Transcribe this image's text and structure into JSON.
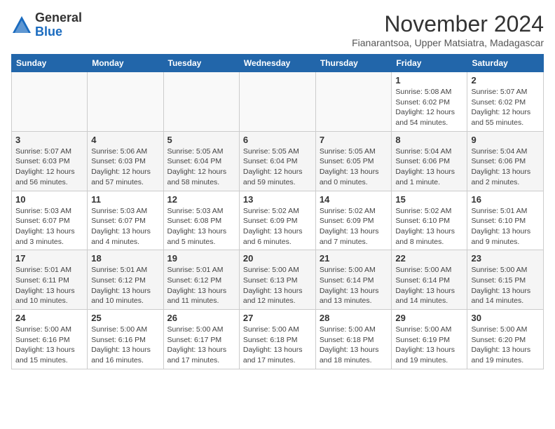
{
  "logo": {
    "general": "General",
    "blue": "Blue"
  },
  "title": "November 2024",
  "subtitle": "Fianarantsoa, Upper Matsiatra, Madagascar",
  "headers": [
    "Sunday",
    "Monday",
    "Tuesday",
    "Wednesday",
    "Thursday",
    "Friday",
    "Saturday"
  ],
  "weeks": [
    [
      {
        "day": "",
        "info": ""
      },
      {
        "day": "",
        "info": ""
      },
      {
        "day": "",
        "info": ""
      },
      {
        "day": "",
        "info": ""
      },
      {
        "day": "",
        "info": ""
      },
      {
        "day": "1",
        "info": "Sunrise: 5:08 AM\nSunset: 6:02 PM\nDaylight: 12 hours\nand 54 minutes."
      },
      {
        "day": "2",
        "info": "Sunrise: 5:07 AM\nSunset: 6:02 PM\nDaylight: 12 hours\nand 55 minutes."
      }
    ],
    [
      {
        "day": "3",
        "info": "Sunrise: 5:07 AM\nSunset: 6:03 PM\nDaylight: 12 hours\nand 56 minutes."
      },
      {
        "day": "4",
        "info": "Sunrise: 5:06 AM\nSunset: 6:03 PM\nDaylight: 12 hours\nand 57 minutes."
      },
      {
        "day": "5",
        "info": "Sunrise: 5:05 AM\nSunset: 6:04 PM\nDaylight: 12 hours\nand 58 minutes."
      },
      {
        "day": "6",
        "info": "Sunrise: 5:05 AM\nSunset: 6:04 PM\nDaylight: 12 hours\nand 59 minutes."
      },
      {
        "day": "7",
        "info": "Sunrise: 5:05 AM\nSunset: 6:05 PM\nDaylight: 13 hours\nand 0 minutes."
      },
      {
        "day": "8",
        "info": "Sunrise: 5:04 AM\nSunset: 6:06 PM\nDaylight: 13 hours\nand 1 minute."
      },
      {
        "day": "9",
        "info": "Sunrise: 5:04 AM\nSunset: 6:06 PM\nDaylight: 13 hours\nand 2 minutes."
      }
    ],
    [
      {
        "day": "10",
        "info": "Sunrise: 5:03 AM\nSunset: 6:07 PM\nDaylight: 13 hours\nand 3 minutes."
      },
      {
        "day": "11",
        "info": "Sunrise: 5:03 AM\nSunset: 6:07 PM\nDaylight: 13 hours\nand 4 minutes."
      },
      {
        "day": "12",
        "info": "Sunrise: 5:03 AM\nSunset: 6:08 PM\nDaylight: 13 hours\nand 5 minutes."
      },
      {
        "day": "13",
        "info": "Sunrise: 5:02 AM\nSunset: 6:09 PM\nDaylight: 13 hours\nand 6 minutes."
      },
      {
        "day": "14",
        "info": "Sunrise: 5:02 AM\nSunset: 6:09 PM\nDaylight: 13 hours\nand 7 minutes."
      },
      {
        "day": "15",
        "info": "Sunrise: 5:02 AM\nSunset: 6:10 PM\nDaylight: 13 hours\nand 8 minutes."
      },
      {
        "day": "16",
        "info": "Sunrise: 5:01 AM\nSunset: 6:10 PM\nDaylight: 13 hours\nand 9 minutes."
      }
    ],
    [
      {
        "day": "17",
        "info": "Sunrise: 5:01 AM\nSunset: 6:11 PM\nDaylight: 13 hours\nand 10 minutes."
      },
      {
        "day": "18",
        "info": "Sunrise: 5:01 AM\nSunset: 6:12 PM\nDaylight: 13 hours\nand 10 minutes."
      },
      {
        "day": "19",
        "info": "Sunrise: 5:01 AM\nSunset: 6:12 PM\nDaylight: 13 hours\nand 11 minutes."
      },
      {
        "day": "20",
        "info": "Sunrise: 5:00 AM\nSunset: 6:13 PM\nDaylight: 13 hours\nand 12 minutes."
      },
      {
        "day": "21",
        "info": "Sunrise: 5:00 AM\nSunset: 6:14 PM\nDaylight: 13 hours\nand 13 minutes."
      },
      {
        "day": "22",
        "info": "Sunrise: 5:00 AM\nSunset: 6:14 PM\nDaylight: 13 hours\nand 14 minutes."
      },
      {
        "day": "23",
        "info": "Sunrise: 5:00 AM\nSunset: 6:15 PM\nDaylight: 13 hours\nand 14 minutes."
      }
    ],
    [
      {
        "day": "24",
        "info": "Sunrise: 5:00 AM\nSunset: 6:16 PM\nDaylight: 13 hours\nand 15 minutes."
      },
      {
        "day": "25",
        "info": "Sunrise: 5:00 AM\nSunset: 6:16 PM\nDaylight: 13 hours\nand 16 minutes."
      },
      {
        "day": "26",
        "info": "Sunrise: 5:00 AM\nSunset: 6:17 PM\nDaylight: 13 hours\nand 17 minutes."
      },
      {
        "day": "27",
        "info": "Sunrise: 5:00 AM\nSunset: 6:18 PM\nDaylight: 13 hours\nand 17 minutes."
      },
      {
        "day": "28",
        "info": "Sunrise: 5:00 AM\nSunset: 6:18 PM\nDaylight: 13 hours\nand 18 minutes."
      },
      {
        "day": "29",
        "info": "Sunrise: 5:00 AM\nSunset: 6:19 PM\nDaylight: 13 hours\nand 19 minutes."
      },
      {
        "day": "30",
        "info": "Sunrise: 5:00 AM\nSunset: 6:20 PM\nDaylight: 13 hours\nand 19 minutes."
      }
    ]
  ]
}
